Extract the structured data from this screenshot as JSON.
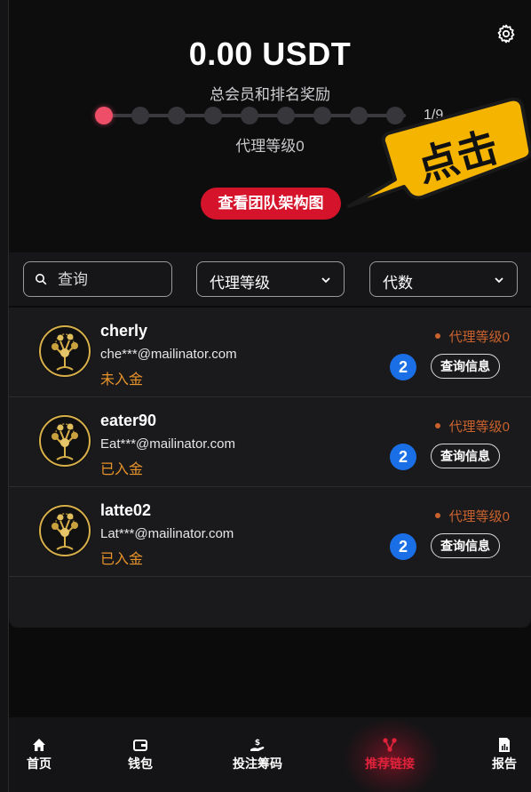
{
  "header": {
    "amount": "0.00 USDT",
    "subtitle": "总会员和排名奖励",
    "progress": {
      "current": 1,
      "total": 9,
      "label": "1/9"
    },
    "level_label": "代理等级0",
    "team_button": "查看团队架构图",
    "callout_text": "点击"
  },
  "filters": {
    "search_placeholder": "查询",
    "agent_level_select": "代理等级",
    "generation_select": "代数"
  },
  "members": [
    {
      "username": "cherly",
      "email": "che***@mailinator.com",
      "status": "未入金",
      "level": "代理等级0",
      "generation": "2",
      "action": "查询信息"
    },
    {
      "username": "eater90",
      "email": "Eat***@mailinator.com",
      "status": "已入金",
      "level": "代理等级0",
      "generation": "2",
      "action": "查询信息"
    },
    {
      "username": "latte02",
      "email": "Lat***@mailinator.com",
      "status": "已入金",
      "level": "代理等级0",
      "generation": "2",
      "action": "查询信息"
    }
  ],
  "nav": {
    "items": [
      {
        "label": "首页",
        "icon": "home-icon"
      },
      {
        "label": "钱包",
        "icon": "wallet-icon"
      },
      {
        "label": "投注筹码",
        "icon": "chips-icon"
      },
      {
        "label": "推荐链接",
        "icon": "referral-icon",
        "active": true
      },
      {
        "label": "报告",
        "icon": "report-icon"
      }
    ]
  },
  "colors": {
    "accent_red": "#d5132b",
    "progress_active": "#ef4e69",
    "status_orange": "#e8932a",
    "level_orange": "#c9622d",
    "badge_blue": "#1b6fe6",
    "callout_yellow": "#f5b400"
  }
}
